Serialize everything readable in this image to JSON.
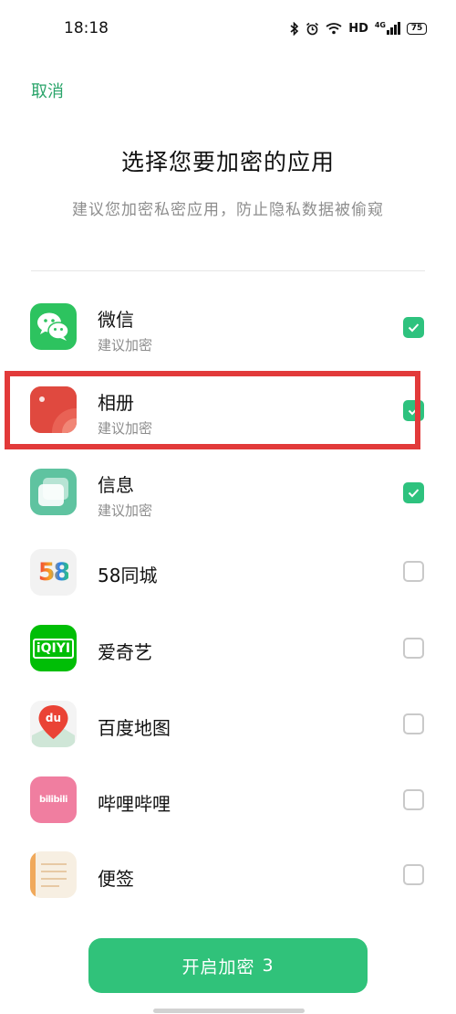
{
  "status_bar": {
    "time": "18:18",
    "network_label": "HD",
    "signal_label": "4G",
    "battery_level": "75"
  },
  "header": {
    "cancel_label": "取消",
    "title": "选择您要加密的应用",
    "subtitle": "建议您加密私密应用，防止隐私数据被偷窥"
  },
  "apps": [
    {
      "name": "微信",
      "sub": "建议加密",
      "checked": true,
      "icon": "wechat-icon"
    },
    {
      "name": "相册",
      "sub": "建议加密",
      "checked": true,
      "icon": "photos-icon",
      "highlighted": true
    },
    {
      "name": "信息",
      "sub": "建议加密",
      "checked": true,
      "icon": "messages-icon"
    },
    {
      "name": "58同城",
      "checked": false,
      "icon": "58-tongcheng-icon",
      "icon_text": "58"
    },
    {
      "name": "爱奇艺",
      "checked": false,
      "icon": "iqiyi-icon",
      "icon_text": "iQIYI"
    },
    {
      "name": "百度地图",
      "checked": false,
      "icon": "baidu-map-icon",
      "icon_text": "du"
    },
    {
      "name": "哔哩哔哩",
      "checked": false,
      "icon": "bilibili-icon",
      "icon_text": "bilibili"
    },
    {
      "name": "便签",
      "checked": false,
      "icon": "notes-icon"
    }
  ],
  "footer": {
    "button_label": "开启加密",
    "selected_count": "3"
  },
  "colors": {
    "accent": "#30c27a",
    "highlight": "#e23a3a"
  }
}
